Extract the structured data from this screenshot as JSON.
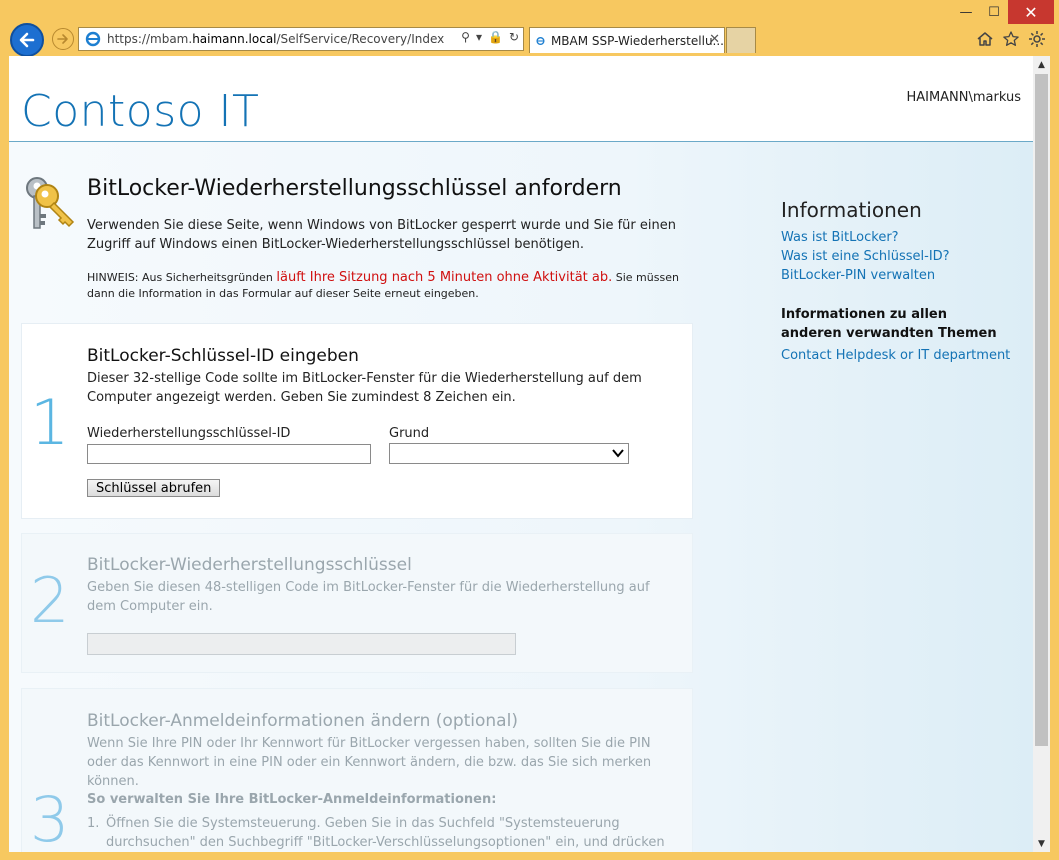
{
  "browser": {
    "url_prefix": "https://mbam.",
    "url_domain": "haimann.local",
    "url_path": "/SelfService/Recovery/Index",
    "tab_title": "MBAM SSP-Wiederherstellu...",
    "controls": {
      "minimize": "—",
      "maximize": "☐",
      "close": "✕",
      "tab_close": "✕",
      "search_glyph": "⚲",
      "dropdown_glyph": "▾",
      "lock_glyph": "🔒",
      "refresh_glyph": "↻"
    },
    "icons": [
      "home-icon",
      "favorites-star-icon",
      "settings-gear-icon"
    ]
  },
  "header": {
    "brand": "Contoso IT",
    "user": "HAIMANN\\markus"
  },
  "main": {
    "title": "BitLocker-Wiederherstellungsschlüssel anfordern",
    "intro": "Verwenden Sie diese Seite, wenn Windows von BitLocker gesperrt wurde und Sie für einen Zugriff auf Windows einen BitLocker-Wiederherstellungsschlüssel benötigen.",
    "note_prefix": "HINWEIS: Aus Sicherheitsgründen ",
    "note_red": "läuft Ihre Sitzung nach 5 Minuten ohne Aktivität ab.",
    "note_suffix": " Sie müssen dann die Information in das Formular auf dieser Seite erneut eingeben."
  },
  "step1": {
    "number": "1",
    "title": "BitLocker-Schlüssel-ID eingeben",
    "desc": "Dieser 32-stellige Code sollte im BitLocker-Fenster für die Wiederherstellung auf dem Computer angezeigt werden. Geben Sie zumindest 8 Zeichen ein.",
    "key_id_label": "Wiederherstellungsschlüssel-ID",
    "key_id_value": "",
    "reason_label": "Grund",
    "reason_value": "",
    "button": "Schlüssel abrufen"
  },
  "step2": {
    "number": "2",
    "title": "BitLocker-Wiederherstellungsschlüssel",
    "desc": "Geben Sie diesen 48-stelligen Code im BitLocker-Fenster für die Wiederherstellung auf dem Computer ein.",
    "value": ""
  },
  "step3": {
    "number": "3",
    "title": "BitLocker-Anmeldeinformationen ändern (optional)",
    "desc": "Wenn Sie Ihre PIN oder Ihr Kennwort für BitLocker vergessen haben, sollten Sie die PIN oder das Kennwort in eine PIN oder ein Kennwort ändern, die bzw. das Sie sich merken können.",
    "howto_title": "So verwalten Sie Ihre BitLocker-Anmeldeinformationen:",
    "items": [
      {
        "n": "1.",
        "text": "Öffnen Sie die Systemsteuerung. Geben Sie in das Suchfeld \"Systemsteuerung durchsuchen\" den Suchbegriff \"BitLocker-Verschlüsselungsoptionen\" ein, und drücken Sie die Eingabetaste."
      }
    ]
  },
  "sidebar": {
    "title": "Informationen",
    "links": [
      "Was ist BitLocker?",
      "Was ist eine Schlüssel-ID?",
      "BitLocker-PIN verwalten"
    ],
    "sub_title": "Informationen zu allen anderen verwandten Themen",
    "contact": "Contact Helpdesk or IT department"
  },
  "colors": {
    "accent": "#1473b5",
    "step_number": "#5bb6e2",
    "warning": "#d01010",
    "frame": "#f7c860"
  }
}
